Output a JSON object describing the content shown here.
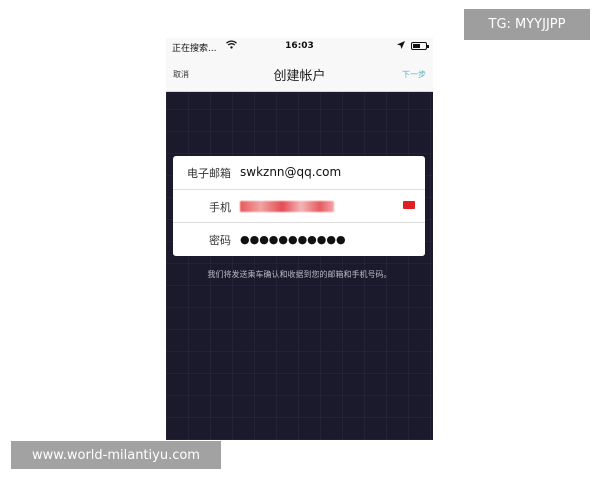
{
  "status_bar": {
    "carrier": "正在搜索...",
    "time": "16:03",
    "wifi_icon": "wifi-icon",
    "location_icon": "location-arrow-icon",
    "battery_icon": "battery-icon"
  },
  "nav": {
    "cancel_label": "取消",
    "title": "创建帐户",
    "next_label": "下一步",
    "next_color": "#5ab0c8"
  },
  "form": {
    "email_label": "电子邮箱",
    "email_value": "swkznn@qq.com",
    "phone_label": "手机",
    "phone_country_icon": "china-flag-icon",
    "password_label": "密码",
    "password_value": "●●●●●●●●●●●"
  },
  "hint": "我们将发送乘车确认和收据到您的邮箱和手机号码。",
  "overlays": {
    "tg_label": "TG: MYYJJPP",
    "url_label": "www.world-milantiyu.com"
  },
  "colors": {
    "background_dark": "#1a1a2c",
    "accent": "#5ab0c8"
  }
}
